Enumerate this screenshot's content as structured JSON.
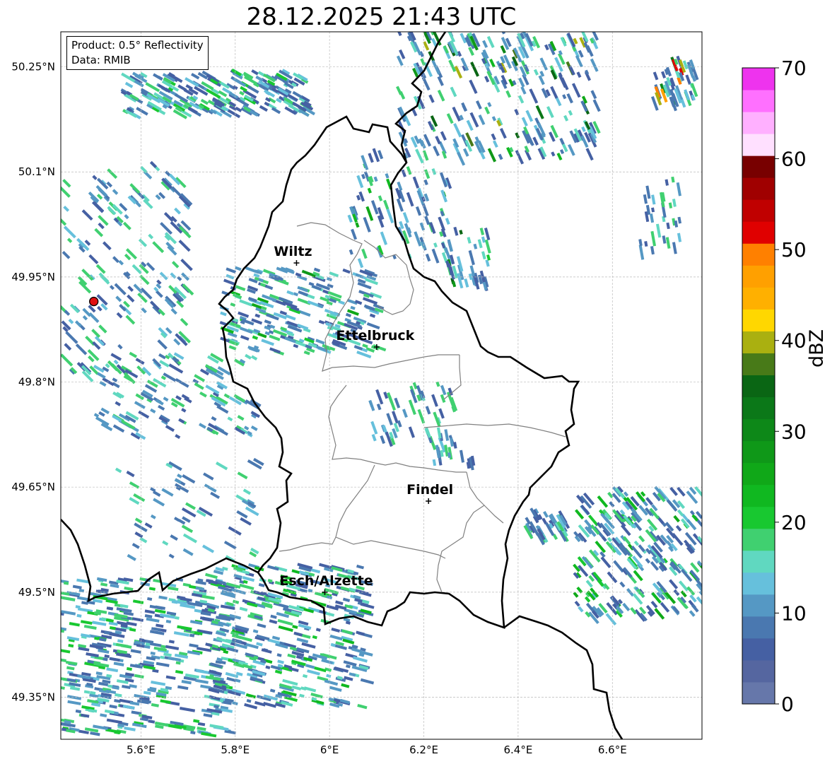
{
  "title": "28.12.2025 21:43 UTC",
  "info": {
    "product": "Product: 0.5° Reflectivity",
    "data": "Data: RMIB"
  },
  "map": {
    "lon_range": [
      5.43,
      6.79
    ],
    "lat_range": [
      49.29,
      50.3
    ],
    "lon_ticks": [
      {
        "value": 5.6,
        "label": "5.6°E"
      },
      {
        "value": 5.8,
        "label": "5.8°E"
      },
      {
        "value": 6.0,
        "label": "6°E"
      },
      {
        "value": 6.2,
        "label": "6.2°E"
      },
      {
        "value": 6.4,
        "label": "6.4°E"
      },
      {
        "value": 6.6,
        "label": "6.6°E"
      }
    ],
    "lat_ticks": [
      {
        "value": 50.25,
        "label": "50.25°N"
      },
      {
        "value": 50.1,
        "label": "50.1°N"
      },
      {
        "value": 49.95,
        "label": "49.95°N"
      },
      {
        "value": 49.8,
        "label": "49.8°N"
      },
      {
        "value": 49.65,
        "label": "49.65°N"
      },
      {
        "value": 49.5,
        "label": "49.5°N"
      },
      {
        "value": 49.35,
        "label": "49.35°N"
      }
    ],
    "grid": true,
    "cities": [
      {
        "name": "Wiltz",
        "lon": 5.93,
        "lat": 49.97
      },
      {
        "name": "Ettelbruck",
        "lon": 6.1,
        "lat": 49.85
      },
      {
        "name": "Findel",
        "lon": 6.21,
        "lat": 49.63
      },
      {
        "name": "Esch/Alzette",
        "lon": 5.99,
        "lat": 49.5
      }
    ],
    "radar_site": {
      "lon": 5.5,
      "lat": 49.915
    }
  },
  "colorbar": {
    "label": "dBZ",
    "min": 0,
    "max": 70,
    "ticks": [
      0,
      10,
      20,
      30,
      40,
      50,
      60,
      70
    ],
    "colors": [
      "#6677aa",
      "#5566a0",
      "#4560a3",
      "#4a78b0",
      "#5598c4",
      "#66c0dc",
      "#60d8c0",
      "#40d070",
      "#18c830",
      "#10b820",
      "#10a818",
      "#0f9818",
      "#0d8818",
      "#0b7818",
      "#0a6614",
      "#487a18",
      "#aab010",
      "#ffd700",
      "#ffb000",
      "#ffa000",
      "#ff8000",
      "#e00000",
      "#c00000",
      "#a00000",
      "#780000",
      "#ffe0ff",
      "#ffb0ff",
      "#ff70ff",
      "#ee33ee"
    ]
  }
}
